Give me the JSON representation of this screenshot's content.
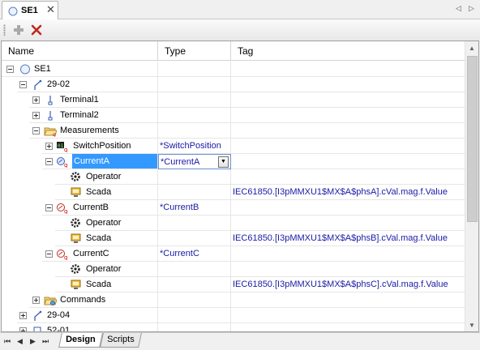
{
  "document_tab": {
    "title": "SE1",
    "close": "✕",
    "prev": "◁",
    "next": "▷"
  },
  "toolbar": {
    "add_icon": "plus-icon",
    "delete_icon": "delete-icon"
  },
  "columns": {
    "name": "Name",
    "type": "Type",
    "tag": "Tag"
  },
  "rows": [
    {
      "name": "SE1",
      "type": "",
      "tag": "",
      "icon": "substation-circle-icon",
      "expander": "minus"
    },
    {
      "name": "29-02",
      "type": "",
      "tag": "",
      "icon": "switch-bay-icon",
      "expander": "minus"
    },
    {
      "name": "Terminal1",
      "type": "",
      "tag": "",
      "icon": "terminal-icon",
      "expander": "plus"
    },
    {
      "name": "Terminal2",
      "type": "",
      "tag": "",
      "icon": "terminal-icon",
      "expander": "plus"
    },
    {
      "name": "Measurements",
      "type": "",
      "tag": "",
      "icon": "folder-open-icon",
      "expander": "minus"
    },
    {
      "name": "SwitchPosition",
      "type": "*SwitchPosition",
      "tag": "",
      "icon": "switch-position-icon",
      "expander": "plus"
    },
    {
      "name": "CurrentA",
      "type": "*CurrentA",
      "tag": "",
      "icon": "current-measurement-icon",
      "expander": "minus",
      "selected": true
    },
    {
      "name": "Operator",
      "type": "",
      "tag": "",
      "icon": "operator-gear-icon"
    },
    {
      "name": "Scada",
      "type": "",
      "tag": "IEC61850.[I3pMMXU1$MX$A$phsA].cVal.mag.f.Value",
      "icon": "scada-monitor-icon"
    },
    {
      "name": "CurrentB",
      "type": "*CurrentB",
      "tag": "",
      "icon": "current-measurement-icon",
      "expander": "minus"
    },
    {
      "name": "Operator",
      "type": "",
      "tag": "",
      "icon": "operator-gear-icon"
    },
    {
      "name": "Scada",
      "type": "",
      "tag": "IEC61850.[I3pMMXU1$MX$A$phsB].cVal.mag.f.Value",
      "icon": "scada-monitor-icon"
    },
    {
      "name": "CurrentC",
      "type": "*CurrentC",
      "tag": "",
      "icon": "current-measurement-icon",
      "expander": "minus"
    },
    {
      "name": "Operator",
      "type": "",
      "tag": "",
      "icon": "operator-gear-icon"
    },
    {
      "name": "Scada",
      "type": "",
      "tag": "IEC61850.[I3pMMXU1$MX$A$phsC].cVal.mag.f.Value",
      "icon": "scada-monitor-icon"
    },
    {
      "name": "Commands",
      "type": "",
      "tag": "",
      "icon": "folder-commands-icon",
      "expander": "plus"
    },
    {
      "name": "29-04",
      "type": "",
      "tag": "",
      "icon": "switch-bay-icon",
      "expander": "plus"
    },
    {
      "name": "52-01",
      "type": "",
      "tag": "",
      "icon": "breaker-icon",
      "expander": "plus"
    }
  ],
  "sheet_tabs": {
    "design": "Design",
    "scripts": "Scripts"
  },
  "pager": {
    "first": "⏮",
    "prev": "◀",
    "next": "▶",
    "last": "⏭"
  },
  "colors": {
    "selection": "#3399ff",
    "type_text": "#1a1aa6",
    "tag_text": "#1a1aa6"
  }
}
